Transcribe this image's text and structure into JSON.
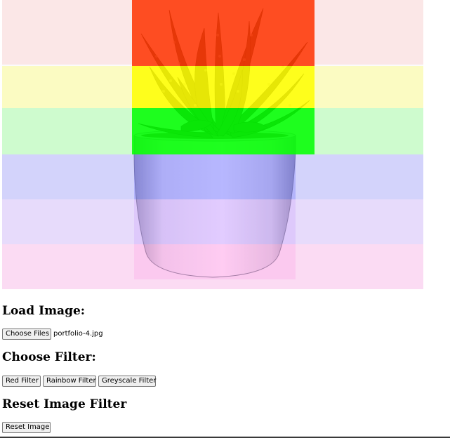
{
  "canvas": {
    "label": "filtered-image",
    "filter_applied": "Rainbow Filter",
    "rainbow_colors": [
      "#ff0000",
      "#ffa500",
      "#ffff00",
      "#00ff00",
      "#0000ff",
      "#4b0082",
      "#ee82ee"
    ]
  },
  "load_section": {
    "heading": "Load Image:",
    "choose_files_label": "Choose Files",
    "file_name": "portfolio-4.jpg"
  },
  "filter_section": {
    "heading": "Choose Filter:",
    "buttons": {
      "red": "Red Filter",
      "rainbow": "Rainbow Filter",
      "greyscale": "Greyscale Filter"
    }
  },
  "reset_section": {
    "heading": "Reset Image Filter",
    "reset_label": "Reset Image"
  }
}
